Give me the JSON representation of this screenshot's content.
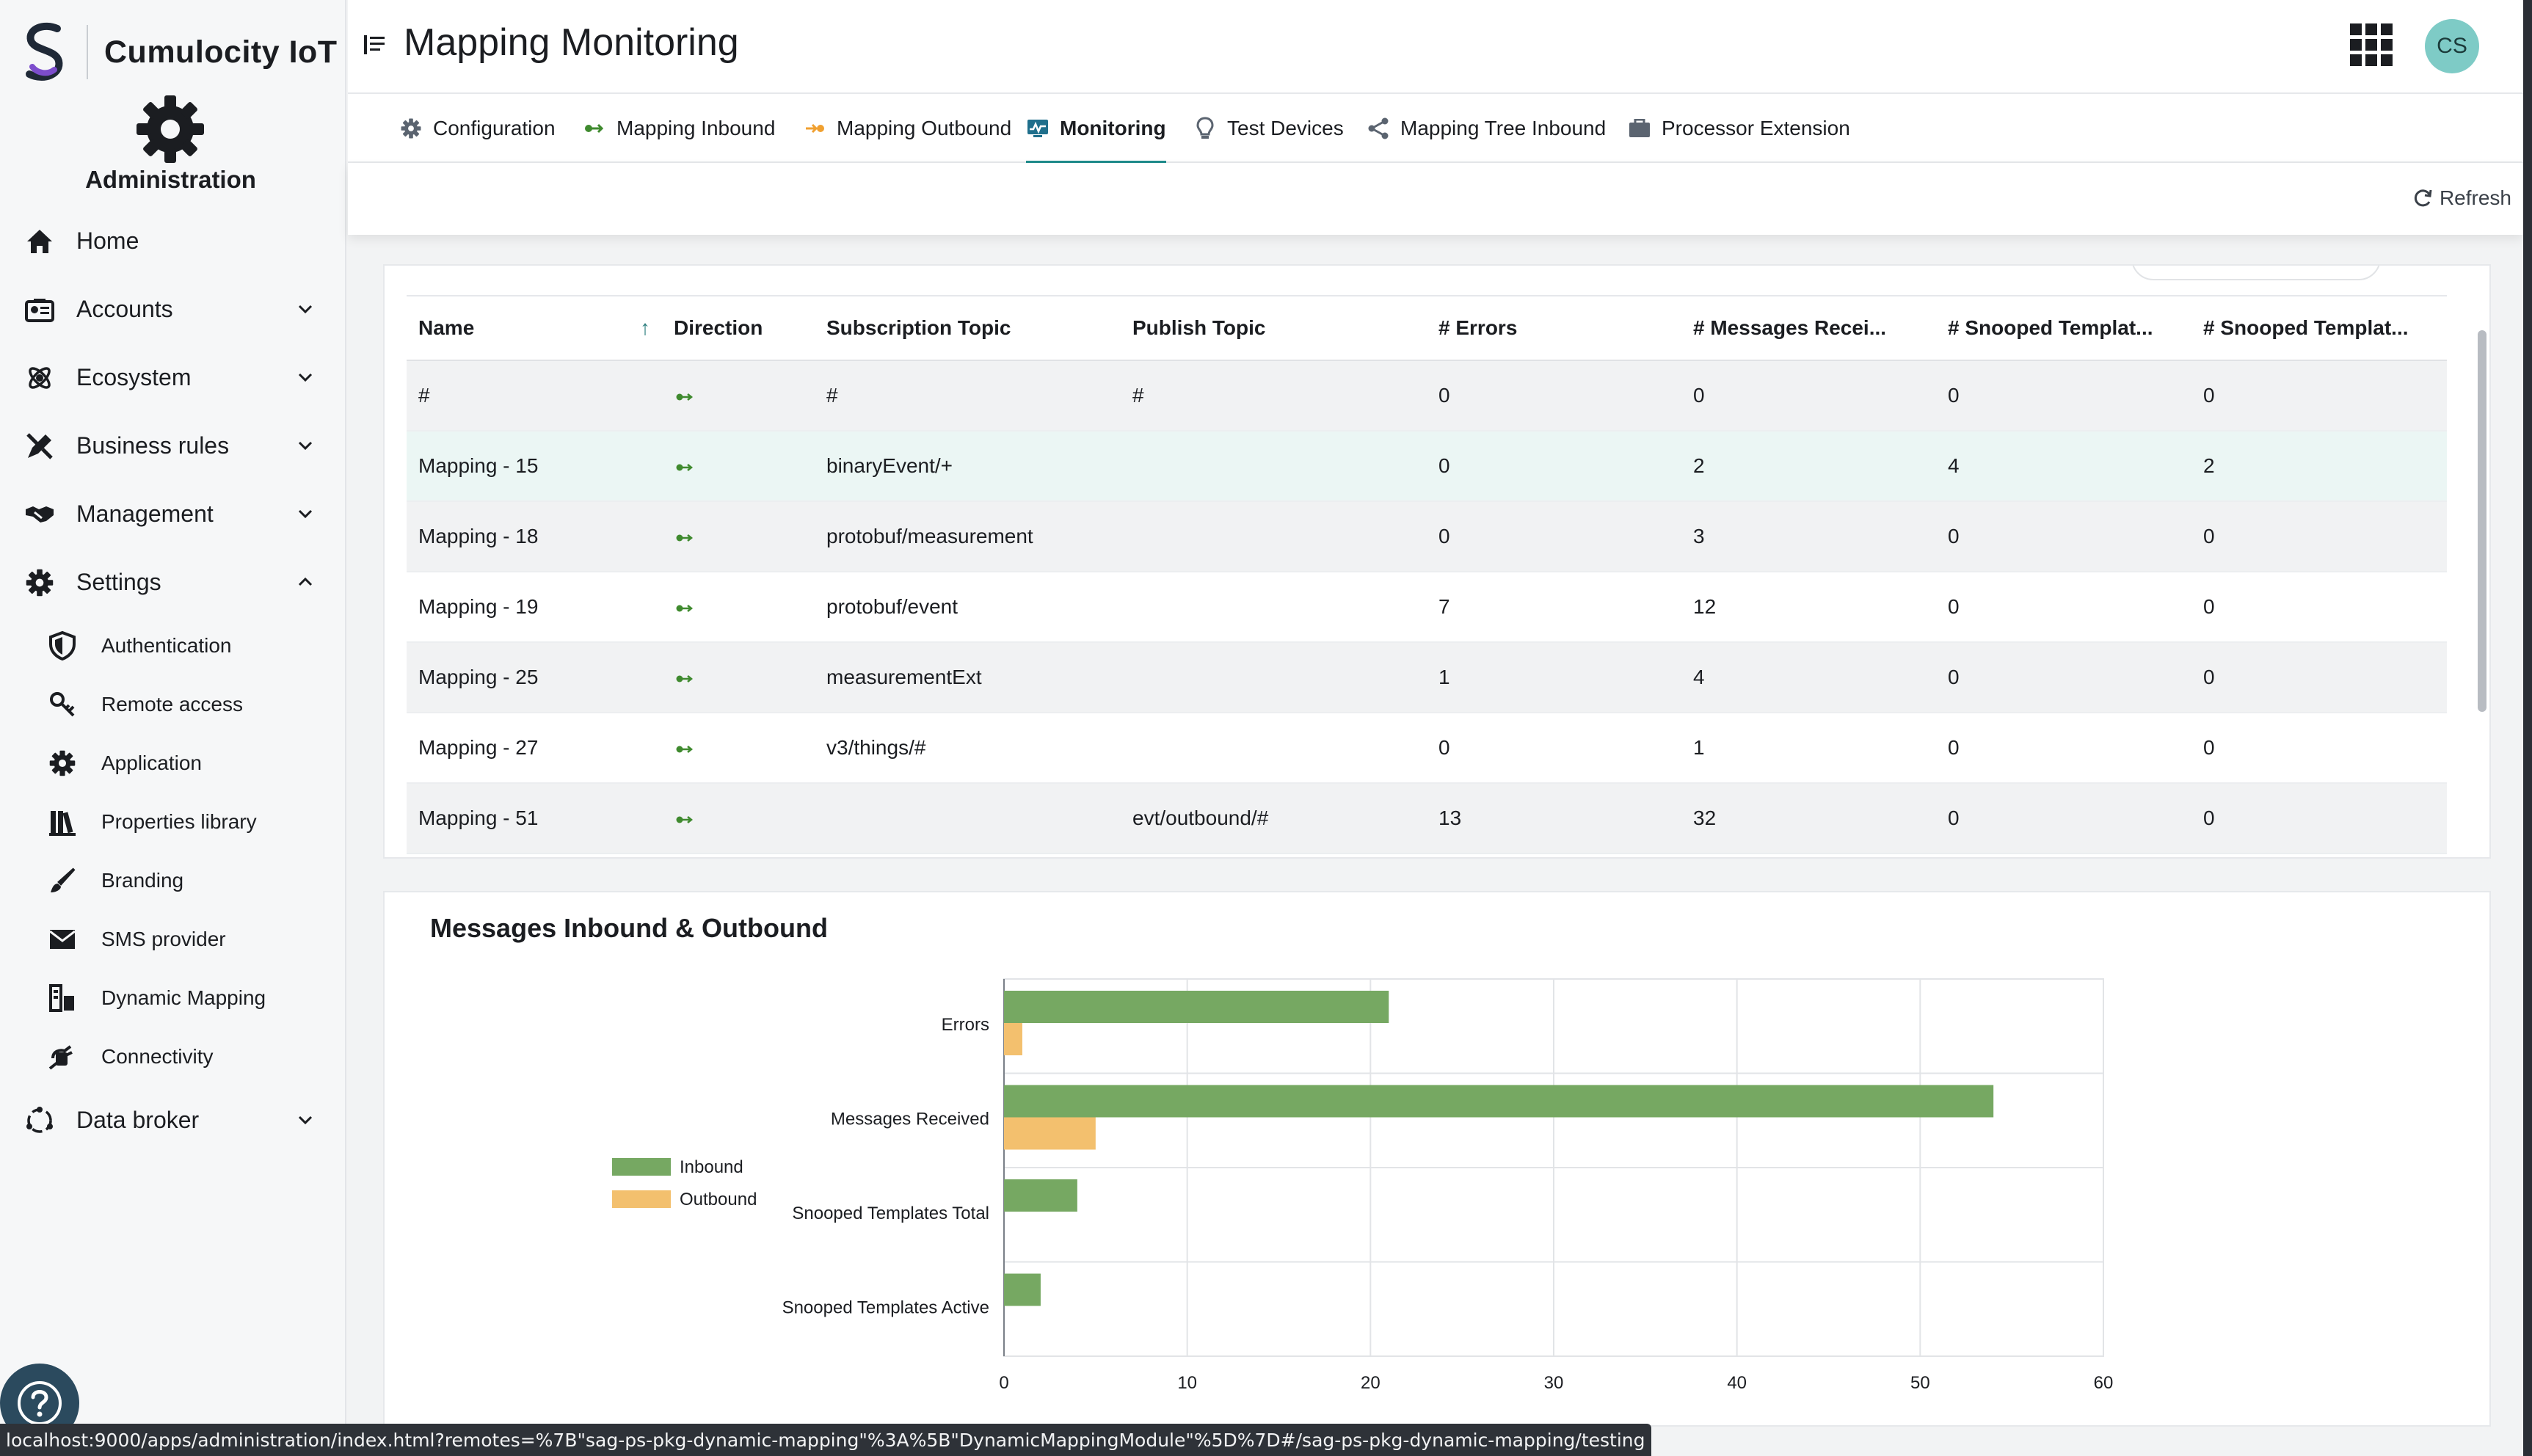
{
  "brand": {
    "name": "Cumulocity IoT",
    "app_name": "Administration",
    "brand_color": "#1f8c8c"
  },
  "sidebar": {
    "items": [
      {
        "label": "Home",
        "icon": "home-icon",
        "expandable": false
      },
      {
        "label": "Accounts",
        "icon": "accounts-icon",
        "expandable": true,
        "expanded": false
      },
      {
        "label": "Ecosystem",
        "icon": "ecosystem-icon",
        "expandable": true,
        "expanded": false
      },
      {
        "label": "Business rules",
        "icon": "business-rules-icon",
        "expandable": true,
        "expanded": false
      },
      {
        "label": "Management",
        "icon": "handshake-icon",
        "expandable": true,
        "expanded": false
      },
      {
        "label": "Settings",
        "icon": "gear-icon",
        "expandable": true,
        "expanded": true
      },
      {
        "label": "Data broker",
        "icon": "data-broker-icon",
        "expandable": true,
        "expanded": false
      }
    ],
    "settings_children": [
      {
        "label": "Authentication",
        "icon": "shield-icon"
      },
      {
        "label": "Remote access",
        "icon": "key-icon"
      },
      {
        "label": "Application",
        "icon": "gear-icon"
      },
      {
        "label": "Properties library",
        "icon": "library-icon"
      },
      {
        "label": "Branding",
        "icon": "brush-icon"
      },
      {
        "label": "SMS provider",
        "icon": "envelope-icon"
      },
      {
        "label": "Dynamic Mapping",
        "icon": "mapping-icon"
      },
      {
        "label": "Connectivity",
        "icon": "plug-icon"
      }
    ]
  },
  "header": {
    "title": "Mapping Monitoring",
    "avatar_initials": "CS"
  },
  "tabs": [
    {
      "label": "Configuration",
      "icon": "gear-icon",
      "active": false
    },
    {
      "label": "Mapping Inbound",
      "icon": "inbound-arrow-icon",
      "active": false
    },
    {
      "label": "Mapping Outbound",
      "icon": "outbound-arrow-icon",
      "active": false
    },
    {
      "label": "Monitoring",
      "icon": "monitor-icon",
      "active": true
    },
    {
      "label": "Test Devices",
      "icon": "lightbulb-icon",
      "active": false
    },
    {
      "label": "Mapping Tree Inbound",
      "icon": "tree-icon",
      "active": false
    },
    {
      "label": "Processor Extension",
      "icon": "extension-icon",
      "active": false
    }
  ],
  "actions": {
    "refresh_label": "Refresh"
  },
  "table": {
    "columns": [
      "Name",
      "Direction",
      "Subscription Topic",
      "Publish Topic",
      "# Errors",
      "# Messages Recei...",
      "# Snooped Templat...",
      "# Snooped Templat..."
    ],
    "rows": [
      {
        "name": "#",
        "direction": "inbound",
        "subscription": "#",
        "publish": "#",
        "errors": "0",
        "messages": "0",
        "snooped_total": "0",
        "snooped_active": "0"
      },
      {
        "name": "Mapping - 15",
        "direction": "inbound",
        "subscription": "binaryEvent/+",
        "publish": "",
        "errors": "0",
        "messages": "2",
        "snooped_total": "4",
        "snooped_active": "2"
      },
      {
        "name": "Mapping - 18",
        "direction": "inbound",
        "subscription": "protobuf/measurement",
        "publish": "",
        "errors": "0",
        "messages": "3",
        "snooped_total": "0",
        "snooped_active": "0"
      },
      {
        "name": "Mapping - 19",
        "direction": "inbound",
        "subscription": "protobuf/event",
        "publish": "",
        "errors": "7",
        "messages": "12",
        "snooped_total": "0",
        "snooped_active": "0"
      },
      {
        "name": "Mapping - 25",
        "direction": "inbound",
        "subscription": "measurementExt",
        "publish": "",
        "errors": "1",
        "messages": "4",
        "snooped_total": "0",
        "snooped_active": "0"
      },
      {
        "name": "Mapping - 27",
        "direction": "inbound",
        "subscription": "v3/things/#",
        "publish": "",
        "errors": "0",
        "messages": "1",
        "snooped_total": "0",
        "snooped_active": "0"
      },
      {
        "name": "Mapping - 51",
        "direction": "inbound",
        "subscription": "",
        "publish": "evt/outbound/#",
        "errors": "13",
        "messages": "32",
        "snooped_total": "0",
        "snooped_active": "0"
      }
    ]
  },
  "chart_title": "Messages Inbound & Outbound",
  "chart_data": {
    "type": "bar",
    "orientation": "horizontal",
    "categories": [
      "Errors",
      "Messages Received",
      "Snooped Templates Total",
      "Snooped Templates Active"
    ],
    "series": [
      {
        "name": "Inbound",
        "values": [
          21,
          54,
          4,
          2
        ],
        "color": "#76a862"
      },
      {
        "name": "Outbound",
        "values": [
          1,
          5,
          0,
          0
        ],
        "color": "#f3c06e"
      }
    ],
    "xlim": [
      0,
      60
    ],
    "xticks": [
      0,
      10,
      20,
      30,
      40,
      50,
      60
    ],
    "grid": true,
    "legend_position": "left"
  },
  "status_url": "localhost:9000/apps/administration/index.html?remotes=%7B\"sag-ps-pkg-dynamic-mapping\"%3A%5B\"DynamicMappingModule\"%5D%7D#/sag-ps-pkg-dynamic-mapping/testing"
}
